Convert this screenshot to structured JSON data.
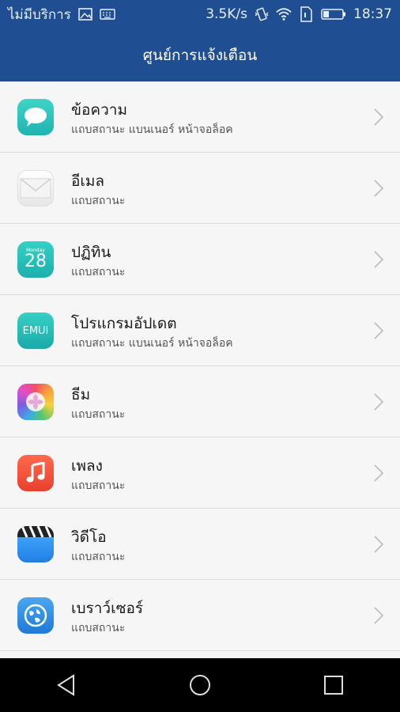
{
  "status_bar": {
    "carrier": "ไม่มีบริการ",
    "speed": "3.5K/s",
    "time": "18:37",
    "icons": [
      "image-icon",
      "keyboard-icon",
      "vibrate-icon",
      "wifi-icon",
      "sim-icon",
      "battery-icon"
    ]
  },
  "header": {
    "title": "ศูนย์การแจ้งเตือน"
  },
  "items": [
    {
      "title": "ข้อความ",
      "subtitle": "แถบสถานะ แบนเนอร์ หน้าจอล็อค",
      "icon": "messages-icon"
    },
    {
      "title": "อีเมล",
      "subtitle": "แถบสถานะ",
      "icon": "email-icon"
    },
    {
      "title": "ปฏิทิน",
      "subtitle": "แถบสถานะ",
      "icon": "calendar-icon",
      "icon_text": "28",
      "icon_small": "Monday"
    },
    {
      "title": "โปรแกรมอัปเดต",
      "subtitle": "แถบสถานะ แบนเนอร์ หน้าจอล็อค",
      "icon": "updater-icon",
      "icon_text": "EMUI"
    },
    {
      "title": "ธีม",
      "subtitle": "แถบสถานะ",
      "icon": "themes-icon"
    },
    {
      "title": "เพลง",
      "subtitle": "แถบสถานะ",
      "icon": "music-icon"
    },
    {
      "title": "วิดีโอ",
      "subtitle": "แถบสถานะ",
      "icon": "video-icon"
    },
    {
      "title": "เบราว์เซอร์",
      "subtitle": "แถบสถานะ",
      "icon": "browser-icon"
    }
  ],
  "nav": {
    "buttons": [
      "back-icon",
      "home-icon",
      "recents-icon"
    ]
  },
  "colors": {
    "header": "#1f4f92",
    "background": "#f6f6f6",
    "navbar": "#000000"
  }
}
